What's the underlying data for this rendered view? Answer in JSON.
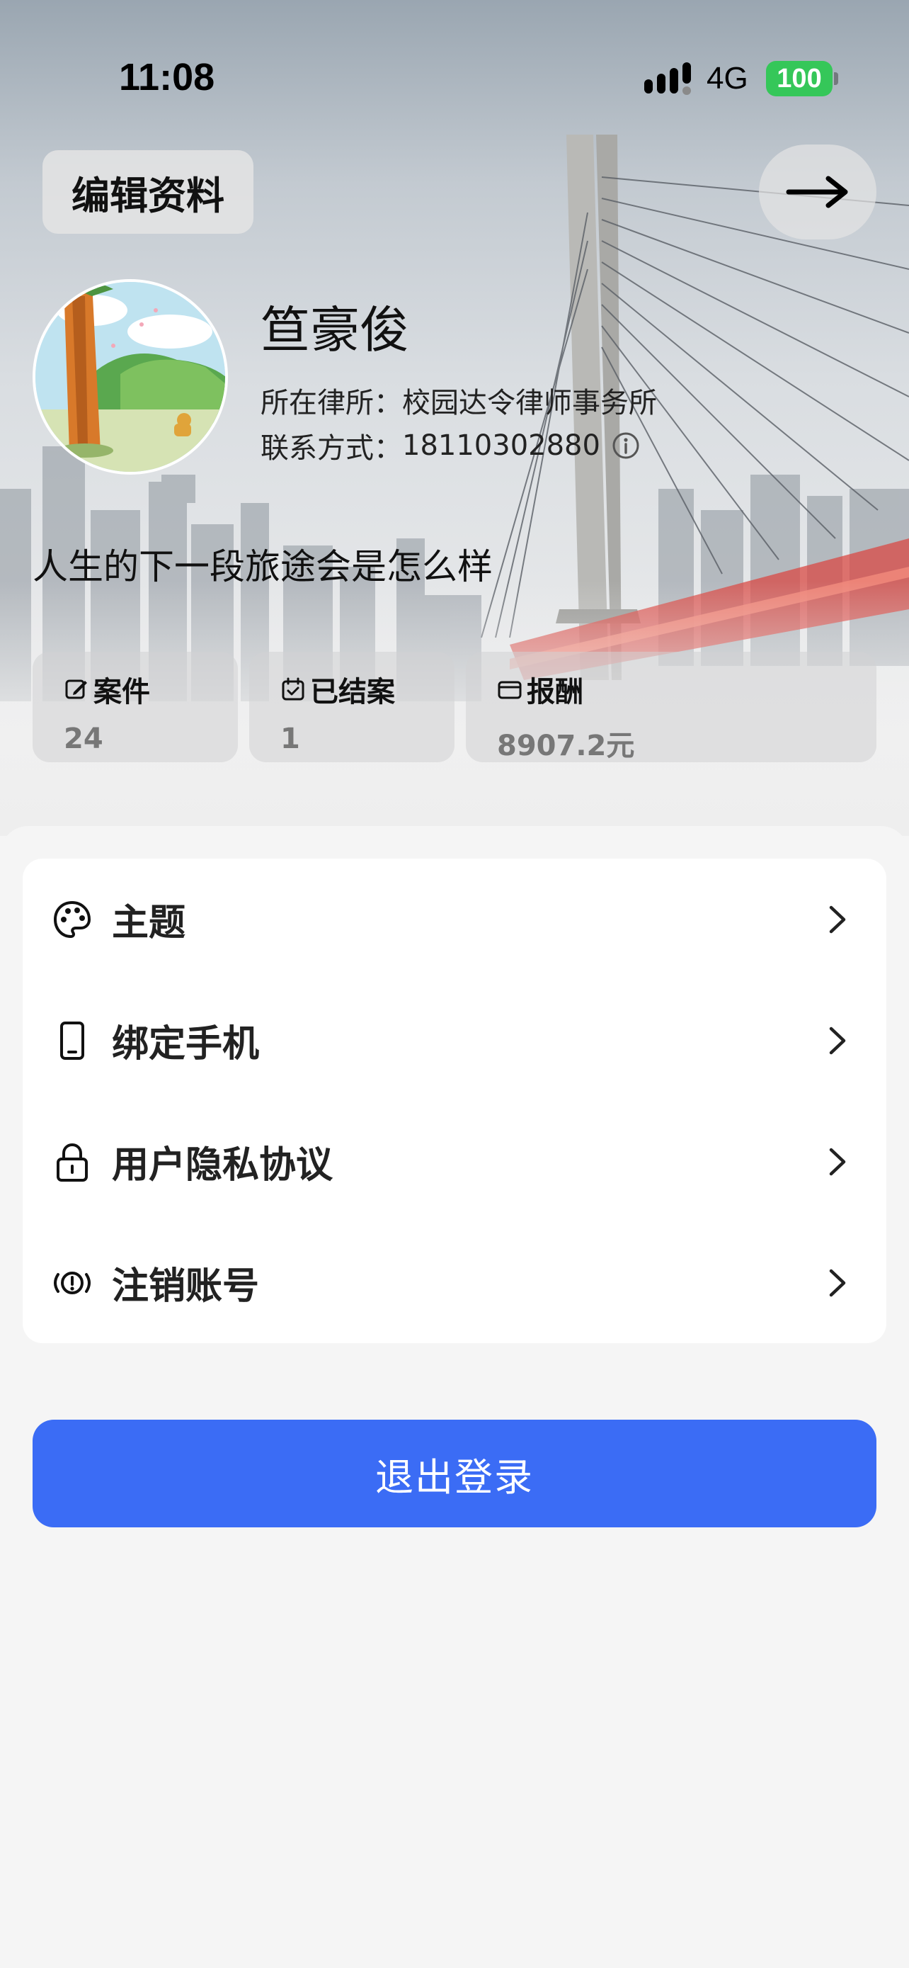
{
  "status_bar": {
    "time": "11:08",
    "network": "4G",
    "battery": "100"
  },
  "header": {
    "edit_profile_label": "编辑资料"
  },
  "profile": {
    "name": "笪豪俊",
    "firm_label": "所在律所：",
    "firm_value": "校园达令律师事务所",
    "contact_label": "联系方式：",
    "contact_value": "18110302880",
    "bio": "人生的下一段旅途会是怎么样"
  },
  "stats": [
    {
      "label": "案件",
      "value": "24",
      "icon": "edit-icon"
    },
    {
      "label": "已结案",
      "value": "1",
      "icon": "calendar-check-icon"
    },
    {
      "label": "报酬",
      "value": "8907.2元",
      "icon": "wallet-icon"
    }
  ],
  "menu": [
    {
      "label": "主题",
      "icon": "palette-icon"
    },
    {
      "label": "绑定手机",
      "icon": "phone-icon"
    },
    {
      "label": "用户隐私协议",
      "icon": "lock-icon"
    },
    {
      "label": "注销账号",
      "icon": "warning-circle-icon"
    }
  ],
  "logout_label": "退出登录",
  "colors": {
    "primary": "#3b6cf5",
    "battery": "#35c759",
    "background": "#f5f5f5"
  }
}
